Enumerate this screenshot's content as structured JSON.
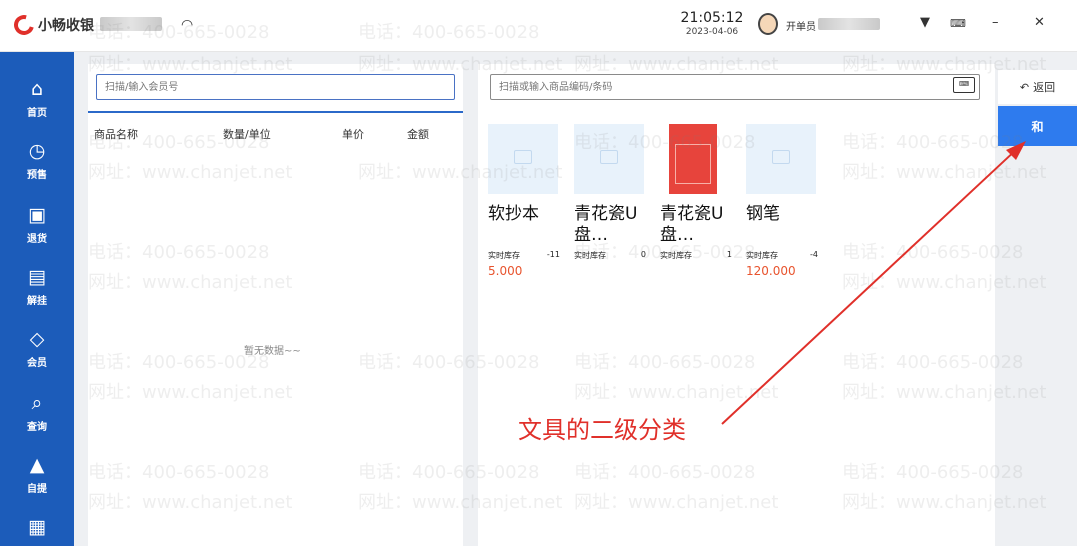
{
  "app": {
    "name": "小畅收银",
    "time": "21:05:12",
    "date": "2023-04-06",
    "operator_label": "开单员"
  },
  "sidebar": {
    "items": [
      {
        "label": "首页",
        "icon": "home-icon"
      },
      {
        "label": "预售",
        "icon": "clock-icon"
      },
      {
        "label": "退货",
        "icon": "return-doc-icon"
      },
      {
        "label": "解挂",
        "icon": "unhang-icon"
      },
      {
        "label": "会员",
        "icon": "diamond-icon"
      },
      {
        "label": "查询",
        "icon": "search-icon"
      },
      {
        "label": "自提",
        "icon": "bag-icon"
      },
      {
        "label": "",
        "icon": "grid-icon"
      }
    ]
  },
  "order": {
    "member_placeholder": "扫描/输入会员号",
    "columns": [
      "商品名称",
      "数量/单位",
      "单价",
      "金额"
    ],
    "empty_text": "暂无数据~~"
  },
  "products": {
    "search_placeholder": "扫描或输入商品编码/条码",
    "stock_label": "实时库存",
    "items": [
      {
        "name": "软抄本",
        "stock": "-11",
        "price": "5.000",
        "image": "placeholder"
      },
      {
        "name": "青花瓷U盘…",
        "stock": "0",
        "price": "",
        "image": "placeholder"
      },
      {
        "name": "青花瓷U盘…",
        "stock": "1",
        "price": "",
        "image": "photo"
      },
      {
        "name": "钢笔",
        "stock": "-4",
        "price": "120.000",
        "image": "placeholder"
      }
    ]
  },
  "categories": {
    "return_label": "返回",
    "items": [
      {
        "label": "和",
        "active": true
      }
    ]
  },
  "watermark": {
    "phone": "电话：400-665-0028",
    "site": "网址：www.chanjet.net"
  },
  "annotation": {
    "text": "文具的二级分类",
    "color": "#e0302a"
  },
  "colors": {
    "sidebar": "#1c5cba",
    "accent": "#2e7bee",
    "price": "#e8542e"
  }
}
